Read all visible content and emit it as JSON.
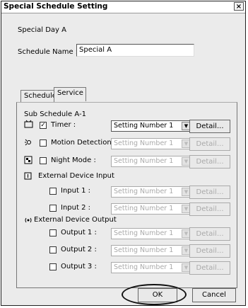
{
  "window": {
    "title": "Special Schedule Setting",
    "close_label": "×"
  },
  "header": {
    "day_label": "Special Day A",
    "schedule_name_label": "Schedule Name :",
    "schedule_name_value": "Special A"
  },
  "tabs": [
    {
      "label": "Schedule",
      "active": false
    },
    {
      "label": "Service",
      "active": true
    }
  ],
  "service": {
    "sub_title": "Sub Schedule A-1",
    "timer": {
      "label": "Timer :",
      "checked": true,
      "select": "Setting Number 1",
      "detail": "Detail..."
    },
    "motion": {
      "label": "Motion Detection :",
      "checked": false,
      "select": "Setting Number 1",
      "detail": "Detail..."
    },
    "night": {
      "label": "Night Mode :",
      "checked": false,
      "select": "Setting Number 1",
      "detail": "Detail..."
    },
    "ext_input": {
      "title": "External Device Input",
      "items": [
        {
          "label": "Input 1 :",
          "select": "Setting Number 1",
          "detail": "Detail..."
        },
        {
          "label": "Input 2 :",
          "select": "Setting Number 1",
          "detail": "Detail..."
        }
      ]
    },
    "ext_output": {
      "title": "External Device Output",
      "items": [
        {
          "label": "Output 1 :",
          "select": "Setting Number 1",
          "detail": "Detail..."
        },
        {
          "label": "Output 2 :",
          "select": "Setting Number 1",
          "detail": "Detail..."
        },
        {
          "label": "Output 3 :",
          "select": "Setting Number 1",
          "detail": "Detail..."
        }
      ]
    }
  },
  "footer": {
    "ok_label": "OK",
    "cancel_label": "Cancel"
  },
  "check_mark": "✓",
  "icons": {
    "timer": "timer-icon",
    "motion": "motion-icon",
    "night": "night-mode-icon",
    "input": "input-icon",
    "output": "output-icon"
  }
}
